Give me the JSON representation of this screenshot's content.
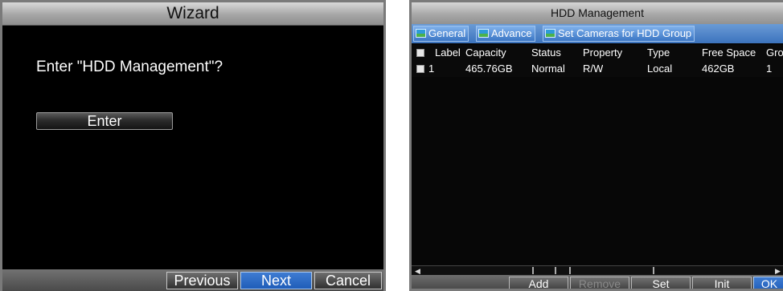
{
  "wizard": {
    "title": "Wizard",
    "prompt": "Enter \"HDD Management\"?",
    "enter_label": "Enter",
    "buttons": {
      "previous": "Previous",
      "next": "Next",
      "cancel": "Cancel"
    }
  },
  "hdd": {
    "title": "HDD Management",
    "tabs": [
      "General",
      "Advance",
      "Set Cameras for HDD Group"
    ],
    "columns": [
      "Label",
      "Capacity",
      "Status",
      "Property",
      "Type",
      "Free Space",
      "Gro"
    ],
    "rows": [
      {
        "label": "1",
        "capacity": "465.76GB",
        "status": "Normal",
        "property": "R/W",
        "type": "Local",
        "free_space": "462GB",
        "group": "1"
      }
    ],
    "buttons": {
      "add": "Add",
      "remove": "Remove",
      "set": "Set",
      "init": "Init",
      "ok": "OK"
    }
  },
  "colors": {
    "accent": "#2d6cc8",
    "background": "#000000",
    "title_bar": "#b0b0b0"
  }
}
